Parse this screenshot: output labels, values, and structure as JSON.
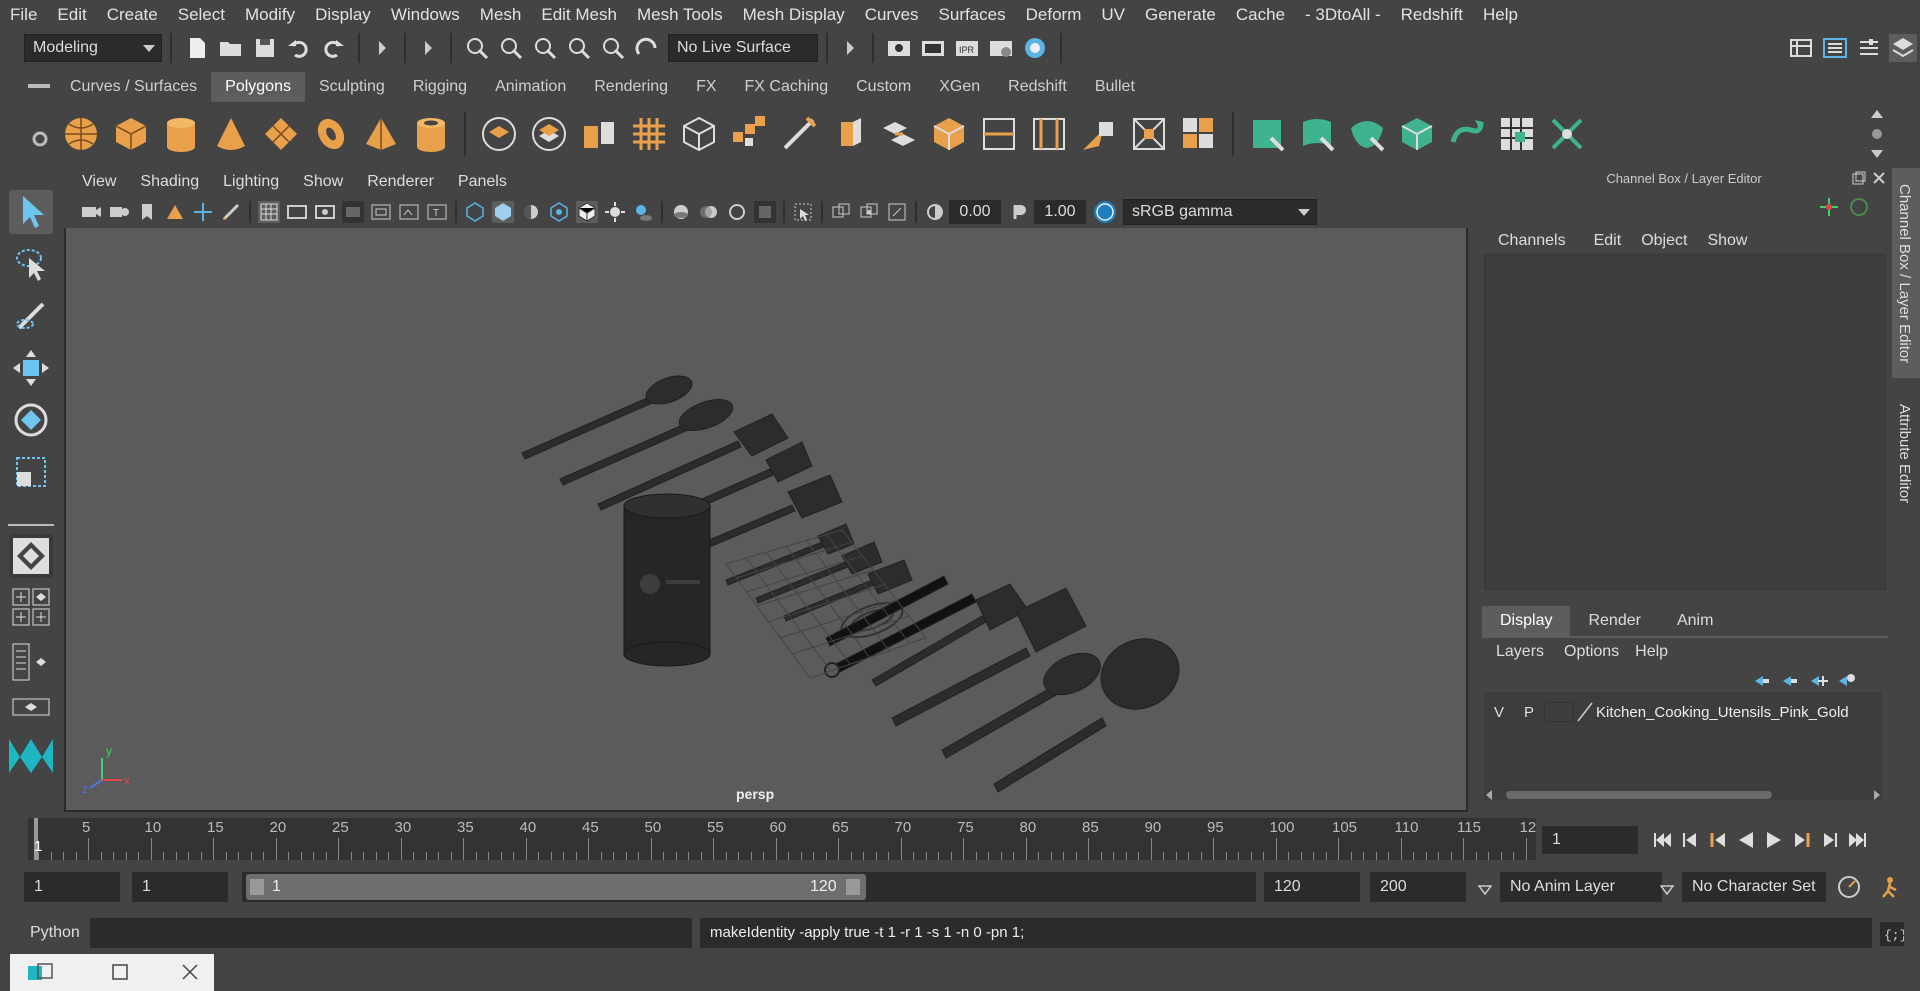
{
  "menubar": {
    "items": [
      "File",
      "Edit",
      "Create",
      "Select",
      "Modify",
      "Display",
      "Windows",
      "Mesh",
      "Edit Mesh",
      "Mesh Tools",
      "Mesh Display",
      "Curves",
      "Surfaces",
      "Deform",
      "UV",
      "Generate",
      "Cache",
      "- 3DtoAll -",
      "Redshift",
      "Help"
    ]
  },
  "statusline": {
    "mode": "Modeling",
    "live_surface": "No Live Surface"
  },
  "shelf": {
    "tabs": [
      "Curves / Surfaces",
      "Polygons",
      "Sculpting",
      "Rigging",
      "Animation",
      "Rendering",
      "FX",
      "FX Caching",
      "Custom",
      "XGen",
      "Redshift",
      "Bullet"
    ],
    "active_tab": "Polygons"
  },
  "viewport": {
    "menu": [
      "View",
      "Shading",
      "Lighting",
      "Show",
      "Renderer",
      "Panels"
    ],
    "exposure": "0.00",
    "gamma": "1.00",
    "color_space": "sRGB gamma",
    "camera_label": "persp",
    "axis_x": "x",
    "axis_y": "y",
    "axis_z": "z"
  },
  "channelbox": {
    "title": "Channel Box / Layer Editor",
    "menu": [
      "Channels",
      "Edit",
      "Object",
      "Show"
    ],
    "layer_tabs": [
      "Display",
      "Render",
      "Anim"
    ],
    "active_layer_tab": "Display",
    "layer_menu": [
      "Layers",
      "Options",
      "Help"
    ],
    "layer": {
      "v": "V",
      "p": "P",
      "name": "Kitchen_Cooking_Utensils_Pink_Gold"
    }
  },
  "sidetabs": {
    "channel": "Channel Box / Layer Editor",
    "attribute": "Attribute Editor"
  },
  "timeline": {
    "start_label": "1",
    "ticks": [
      "5",
      "10",
      "15",
      "20",
      "25",
      "30",
      "35",
      "40",
      "45",
      "50",
      "55",
      "60",
      "65",
      "70",
      "75",
      "80",
      "85",
      "90",
      "95",
      "100",
      "105",
      "110",
      "115",
      "12"
    ],
    "current_frame": "1"
  },
  "range": {
    "start": "1",
    "playback_start": "1",
    "slider_start": "1",
    "slider_end": "120",
    "playback_end": "120",
    "end": "200",
    "anim_layer": "No Anim Layer",
    "character_set": "No Character Set"
  },
  "cmdline": {
    "language": "Python",
    "output": "makeIdentity -apply true -t 1 -r 1 -s 1 -n 0 -pn 1;"
  },
  "colors": {
    "accent_orange": "#e8a04a",
    "accent_teal": "#3fb38f",
    "accent_blue": "#5ab4e6"
  }
}
